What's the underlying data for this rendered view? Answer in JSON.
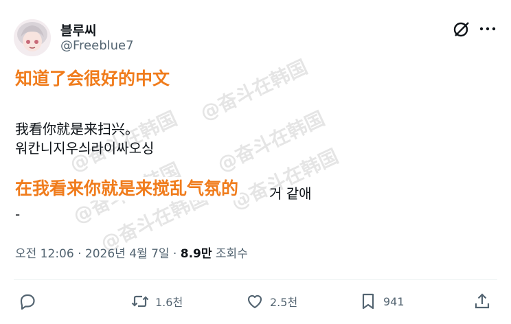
{
  "user": {
    "display_name": "블루씨",
    "handle": "@Freeblue7"
  },
  "overlay": {
    "top_caption": "知道了会很好的中文",
    "mid_caption": "在我看来你就是来搅乱气氛的",
    "mid_tail": "거 같애"
  },
  "tweet": {
    "line1": "我看你就是来扫兴。",
    "line2": "워칸니지우싀라이싸오싱",
    "line3": "-"
  },
  "meta": {
    "time": "오전 12:06",
    "sep1": " · ",
    "date": "2026년 4월 7일",
    "sep2": " · ",
    "views": "8.9만",
    "views_label": " 조회수"
  },
  "actions": {
    "reply_count": "",
    "retweet_count": "1.6천",
    "like_count": "2.5천",
    "bookmark_count": "941"
  },
  "watermark": "@奋斗在韩国",
  "icons": [
    "grok-icon",
    "more-icon",
    "reply-icon",
    "retweet-icon",
    "like-icon",
    "bookmark-icon",
    "share-icon"
  ]
}
